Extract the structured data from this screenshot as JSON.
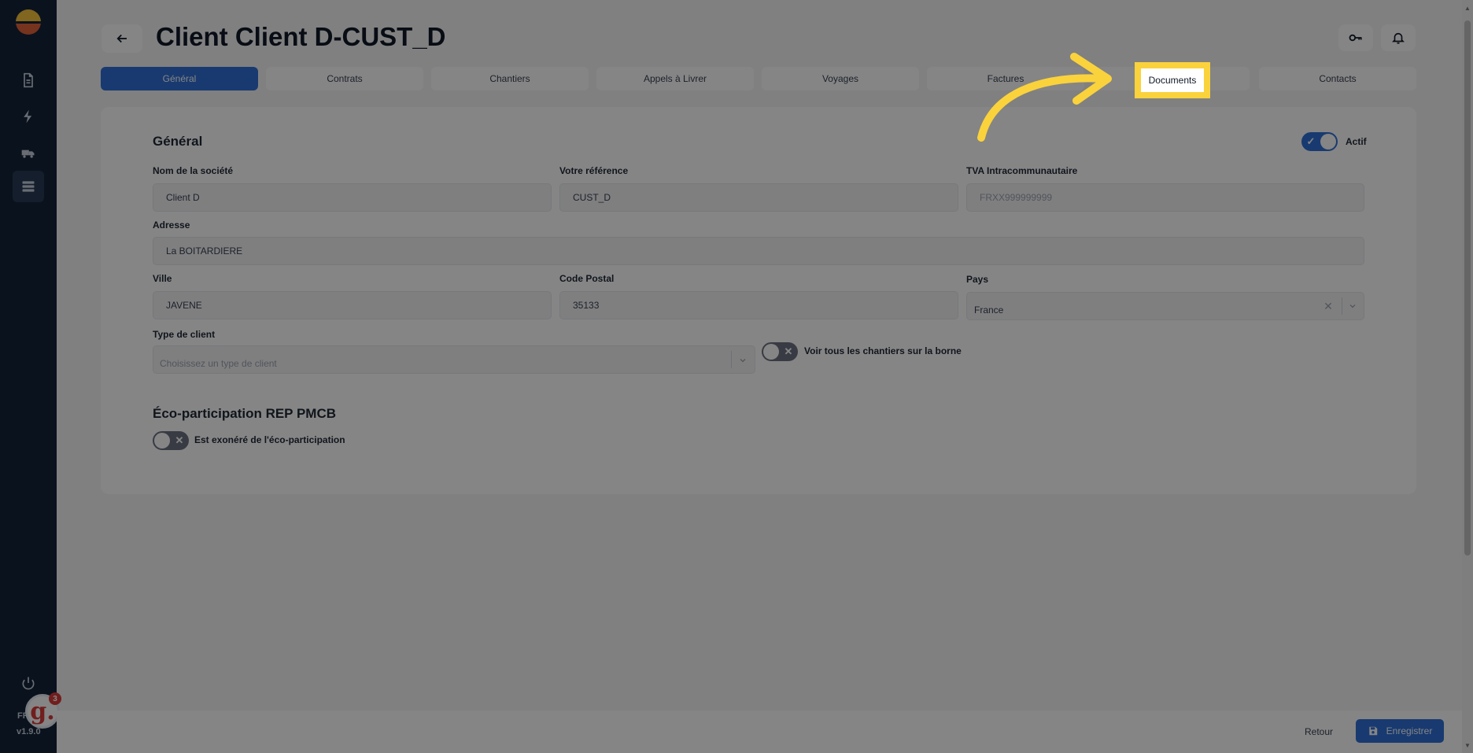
{
  "app": {
    "title": "Client Client D-CUST_D",
    "version_prefix": "FR",
    "version": "v1.9.0",
    "guide_count": "3",
    "guide_letter": "g."
  },
  "sidebar": {
    "items": [
      {
        "icon": "document-icon"
      },
      {
        "icon": "lightning-icon"
      },
      {
        "icon": "truck-icon"
      },
      {
        "icon": "database-icon",
        "active": true
      }
    ],
    "power_icon": "power-icon"
  },
  "header": {
    "back_icon": "arrow-left-icon",
    "key_icon": "key-icon",
    "bell_icon": "bell-icon"
  },
  "tabs": [
    {
      "label": "Général",
      "active": true
    },
    {
      "label": "Contrats"
    },
    {
      "label": "Chantiers"
    },
    {
      "label": "Appels à Livrer"
    },
    {
      "label": "Voyages"
    },
    {
      "label": "Factures"
    },
    {
      "label": "Documents"
    },
    {
      "label": "Contacts"
    }
  ],
  "general": {
    "title": "Général",
    "actif_label": "Actif",
    "company_label": "Nom de la société",
    "company_value": "Client D",
    "reference_label": "Votre référence",
    "reference_value": "CUST_D",
    "vat_label": "TVA Intracommunautaire",
    "vat_placeholder": "FRXX999999999",
    "address_label": "Adresse",
    "address_value": "La BOITARDIERE",
    "city_label": "Ville",
    "city_value": "JAVENE",
    "postal_label": "Code Postal",
    "postal_value": "35133",
    "country_label": "Pays",
    "country_value": "France",
    "client_type_label": "Type de client",
    "client_type_placeholder": "Choisissez un type de client",
    "show_sites_label": "Voir tous les chantiers sur la borne"
  },
  "eco": {
    "title": "Éco-participation REP PMCB",
    "exempt_label": "Est exonéré de l'éco-participation"
  },
  "footer": {
    "retour_label": "Retour",
    "save_label": "Enregistrer"
  },
  "highlight": {
    "label": "Documents",
    "color": "#fad23c"
  },
  "colors": {
    "accent": "#2f6fd6",
    "sidebar": "#14243a",
    "highlight": "#fad23c"
  }
}
